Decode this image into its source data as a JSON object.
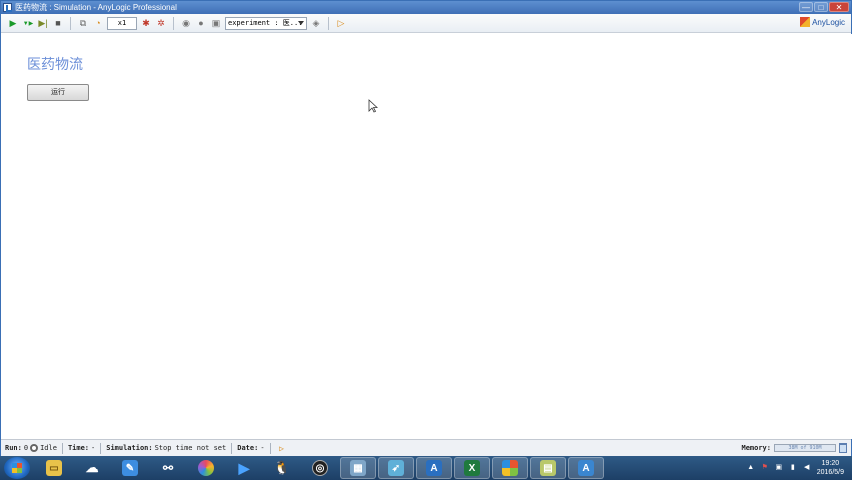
{
  "window": {
    "title": "医药物流 : Simulation - AnyLogic Professional",
    "controls": {
      "minimize": "—",
      "maximize": "□",
      "close": "✕"
    }
  },
  "toolbar": {
    "speed_value": "x1",
    "experiment_value": "experiment : 医...",
    "brand": "AnyLogic"
  },
  "main": {
    "title": "医药物流",
    "run_button_label": "运行"
  },
  "status": {
    "run_label": "Run:",
    "run_value": "0",
    "state": "Idle",
    "time_label": "Time:",
    "time_value": "-",
    "simulation_label": "Simulation:",
    "simulation_value": "Stop time not set",
    "date_label": "Date:",
    "date_value": "-",
    "memory_label": "Memory:",
    "memory_value": "38M of 910M"
  },
  "taskbar": {
    "clock_time": "19:20",
    "clock_date": "2016/5/9"
  },
  "colors": {
    "title_accent": "#6c8fd8",
    "taskbar": "#1d3f66",
    "titlebar": "#3f6fb6"
  }
}
